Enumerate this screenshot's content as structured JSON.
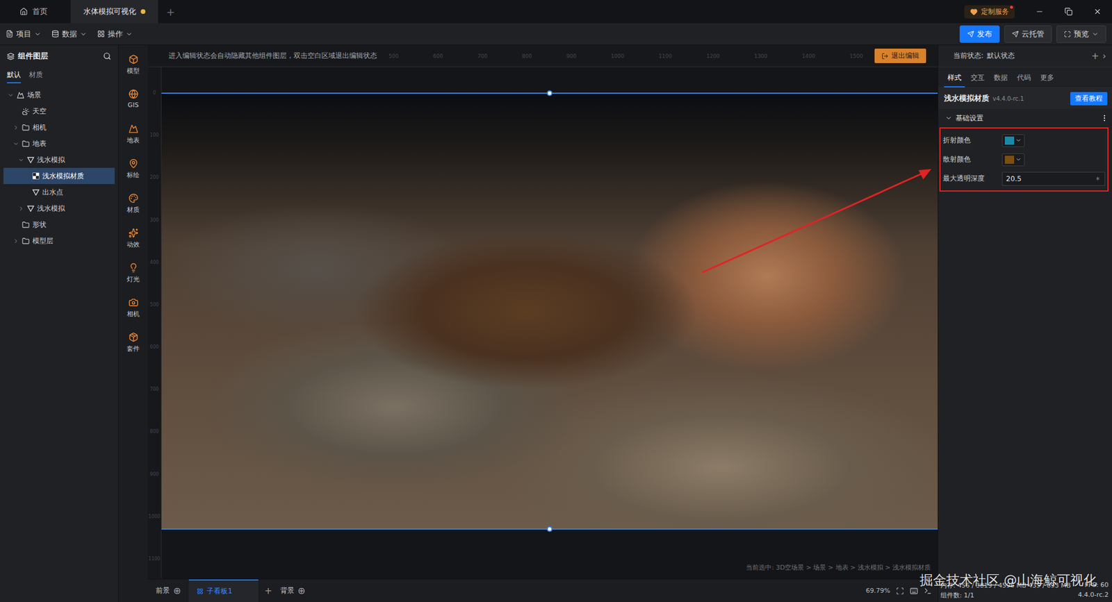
{
  "window": {
    "tabs": [
      {
        "label": "首页",
        "kind": "home",
        "selected": false,
        "unsaved": false
      },
      {
        "label": "水体模拟可视化",
        "kind": "doc",
        "selected": true,
        "unsaved": true
      }
    ],
    "new_tab": "+",
    "service": "定制服务",
    "controls": [
      {
        "kind": "minimize",
        "label": "最小化"
      },
      {
        "kind": "restore",
        "label": "还原"
      },
      {
        "kind": "close",
        "label": "关闭"
      }
    ]
  },
  "toolbar": {
    "menus": [
      {
        "label": "项目",
        "kind": "project"
      },
      {
        "label": "数据",
        "kind": "data"
      },
      {
        "label": "操作",
        "kind": "operate"
      }
    ],
    "actions": [
      {
        "label": "发布",
        "kind": "publish",
        "primary": true
      },
      {
        "label": "云托管",
        "kind": "cloud",
        "primary": false
      },
      {
        "label": "预览",
        "kind": "preview",
        "primary": false
      }
    ]
  },
  "layers": {
    "title": "组件图层",
    "tabs": [
      {
        "label": "默认",
        "selected": true
      },
      {
        "label": "材质",
        "selected": false
      }
    ],
    "tree": [
      {
        "label": "场景",
        "kind": "scene",
        "depth": 0,
        "has_children": true,
        "expanded": true,
        "selected": false
      },
      {
        "label": "天空",
        "kind": "sky",
        "depth": 1,
        "has_children": false,
        "expanded": false,
        "selected": false
      },
      {
        "label": "相机",
        "kind": "folder",
        "depth": 1,
        "has_children": true,
        "expanded": false,
        "selected": false
      },
      {
        "label": "地表",
        "kind": "folder",
        "depth": 1,
        "has_children": true,
        "expanded": true,
        "selected": false
      },
      {
        "label": "浅水模拟",
        "kind": "filter",
        "depth": 2,
        "has_children": true,
        "expanded": true,
        "selected": false
      },
      {
        "label": "浅水模拟材质",
        "kind": "material",
        "depth": 3,
        "has_children": false,
        "expanded": false,
        "selected": true
      },
      {
        "label": "出水点",
        "kind": "filter",
        "depth": 3,
        "has_children": false,
        "expanded": false,
        "selected": false
      },
      {
        "label": "浅水模拟",
        "kind": "filter",
        "depth": 2,
        "has_children": true,
        "expanded": false,
        "selected": false
      },
      {
        "label": "形状",
        "kind": "folder",
        "depth": 1,
        "has_children": false,
        "expanded": false,
        "selected": false
      },
      {
        "label": "模型层",
        "kind": "folder",
        "depth": 1,
        "has_children": true,
        "expanded": false,
        "selected": false
      }
    ]
  },
  "tools": [
    {
      "label": "模型",
      "kind": "model"
    },
    {
      "label": "GIS",
      "kind": "gis"
    },
    {
      "label": "地表",
      "kind": "terrain"
    },
    {
      "label": "标绘",
      "kind": "plot"
    },
    {
      "label": "材质",
      "kind": "material"
    },
    {
      "label": "动效",
      "kind": "effect"
    },
    {
      "label": "灯光",
      "kind": "light"
    },
    {
      "label": "相机",
      "kind": "camera"
    },
    {
      "label": "套件",
      "kind": "kit"
    }
  ],
  "canvas": {
    "hint": "进入编辑状态会自动隐藏其他组件图层，双击空白区域退出编辑状态",
    "exit_button": "退出编辑",
    "ruler_top": [
      "500",
      "600",
      "700",
      "800",
      "900",
      "1000",
      "1100",
      "1200",
      "1300",
      "1400",
      "1500"
    ],
    "ruler_left": [
      "0",
      "100",
      "200",
      "300",
      "400",
      "500",
      "600",
      "700",
      "800",
      "900",
      "1000",
      "1100"
    ],
    "breadcrumb": "当前选中: 3D空场景 > 场景 > 地表 > 浅水模拟 > 浅水模拟材质"
  },
  "boards": {
    "foreground": "前景",
    "background": "背景",
    "add_layer": "⊕",
    "tabs": [
      {
        "label": "子看板1",
        "selected": true
      }
    ],
    "add": "+",
    "zoom": "69.79%"
  },
  "inspector": {
    "state_label": "当前状态:",
    "state": "默认状态",
    "add": "+",
    "more": "›",
    "tabs": [
      {
        "label": "样式",
        "selected": true
      },
      {
        "label": "交互",
        "selected": false
      },
      {
        "label": "数据",
        "selected": false
      },
      {
        "label": "代码",
        "selected": false
      },
      {
        "label": "更多",
        "selected": false
      }
    ],
    "component": "浅水模拟材质",
    "version": "v4.4.0-rc.1",
    "tutorial": "查看教程",
    "section": {
      "title": "基础设置",
      "expanded": true
    },
    "fields": [
      {
        "label": "折射颜色",
        "kind": "color",
        "color": "#1a8aa8"
      },
      {
        "label": "散射颜色",
        "kind": "color",
        "color": "#7a4f10"
      },
      {
        "label": "最大透明深度",
        "kind": "number",
        "value": "20.5"
      }
    ],
    "highlighted": true
  },
  "status": {
    "memory": "内存: 456 / 3819 / 4596 MB 435 / 693 MB",
    "fps": "FPS: 60",
    "components": "组件数: 1/1",
    "version": "4.4.0-rc.2"
  },
  "watermark": "掘金技术社区 @山海鲸可视化"
}
